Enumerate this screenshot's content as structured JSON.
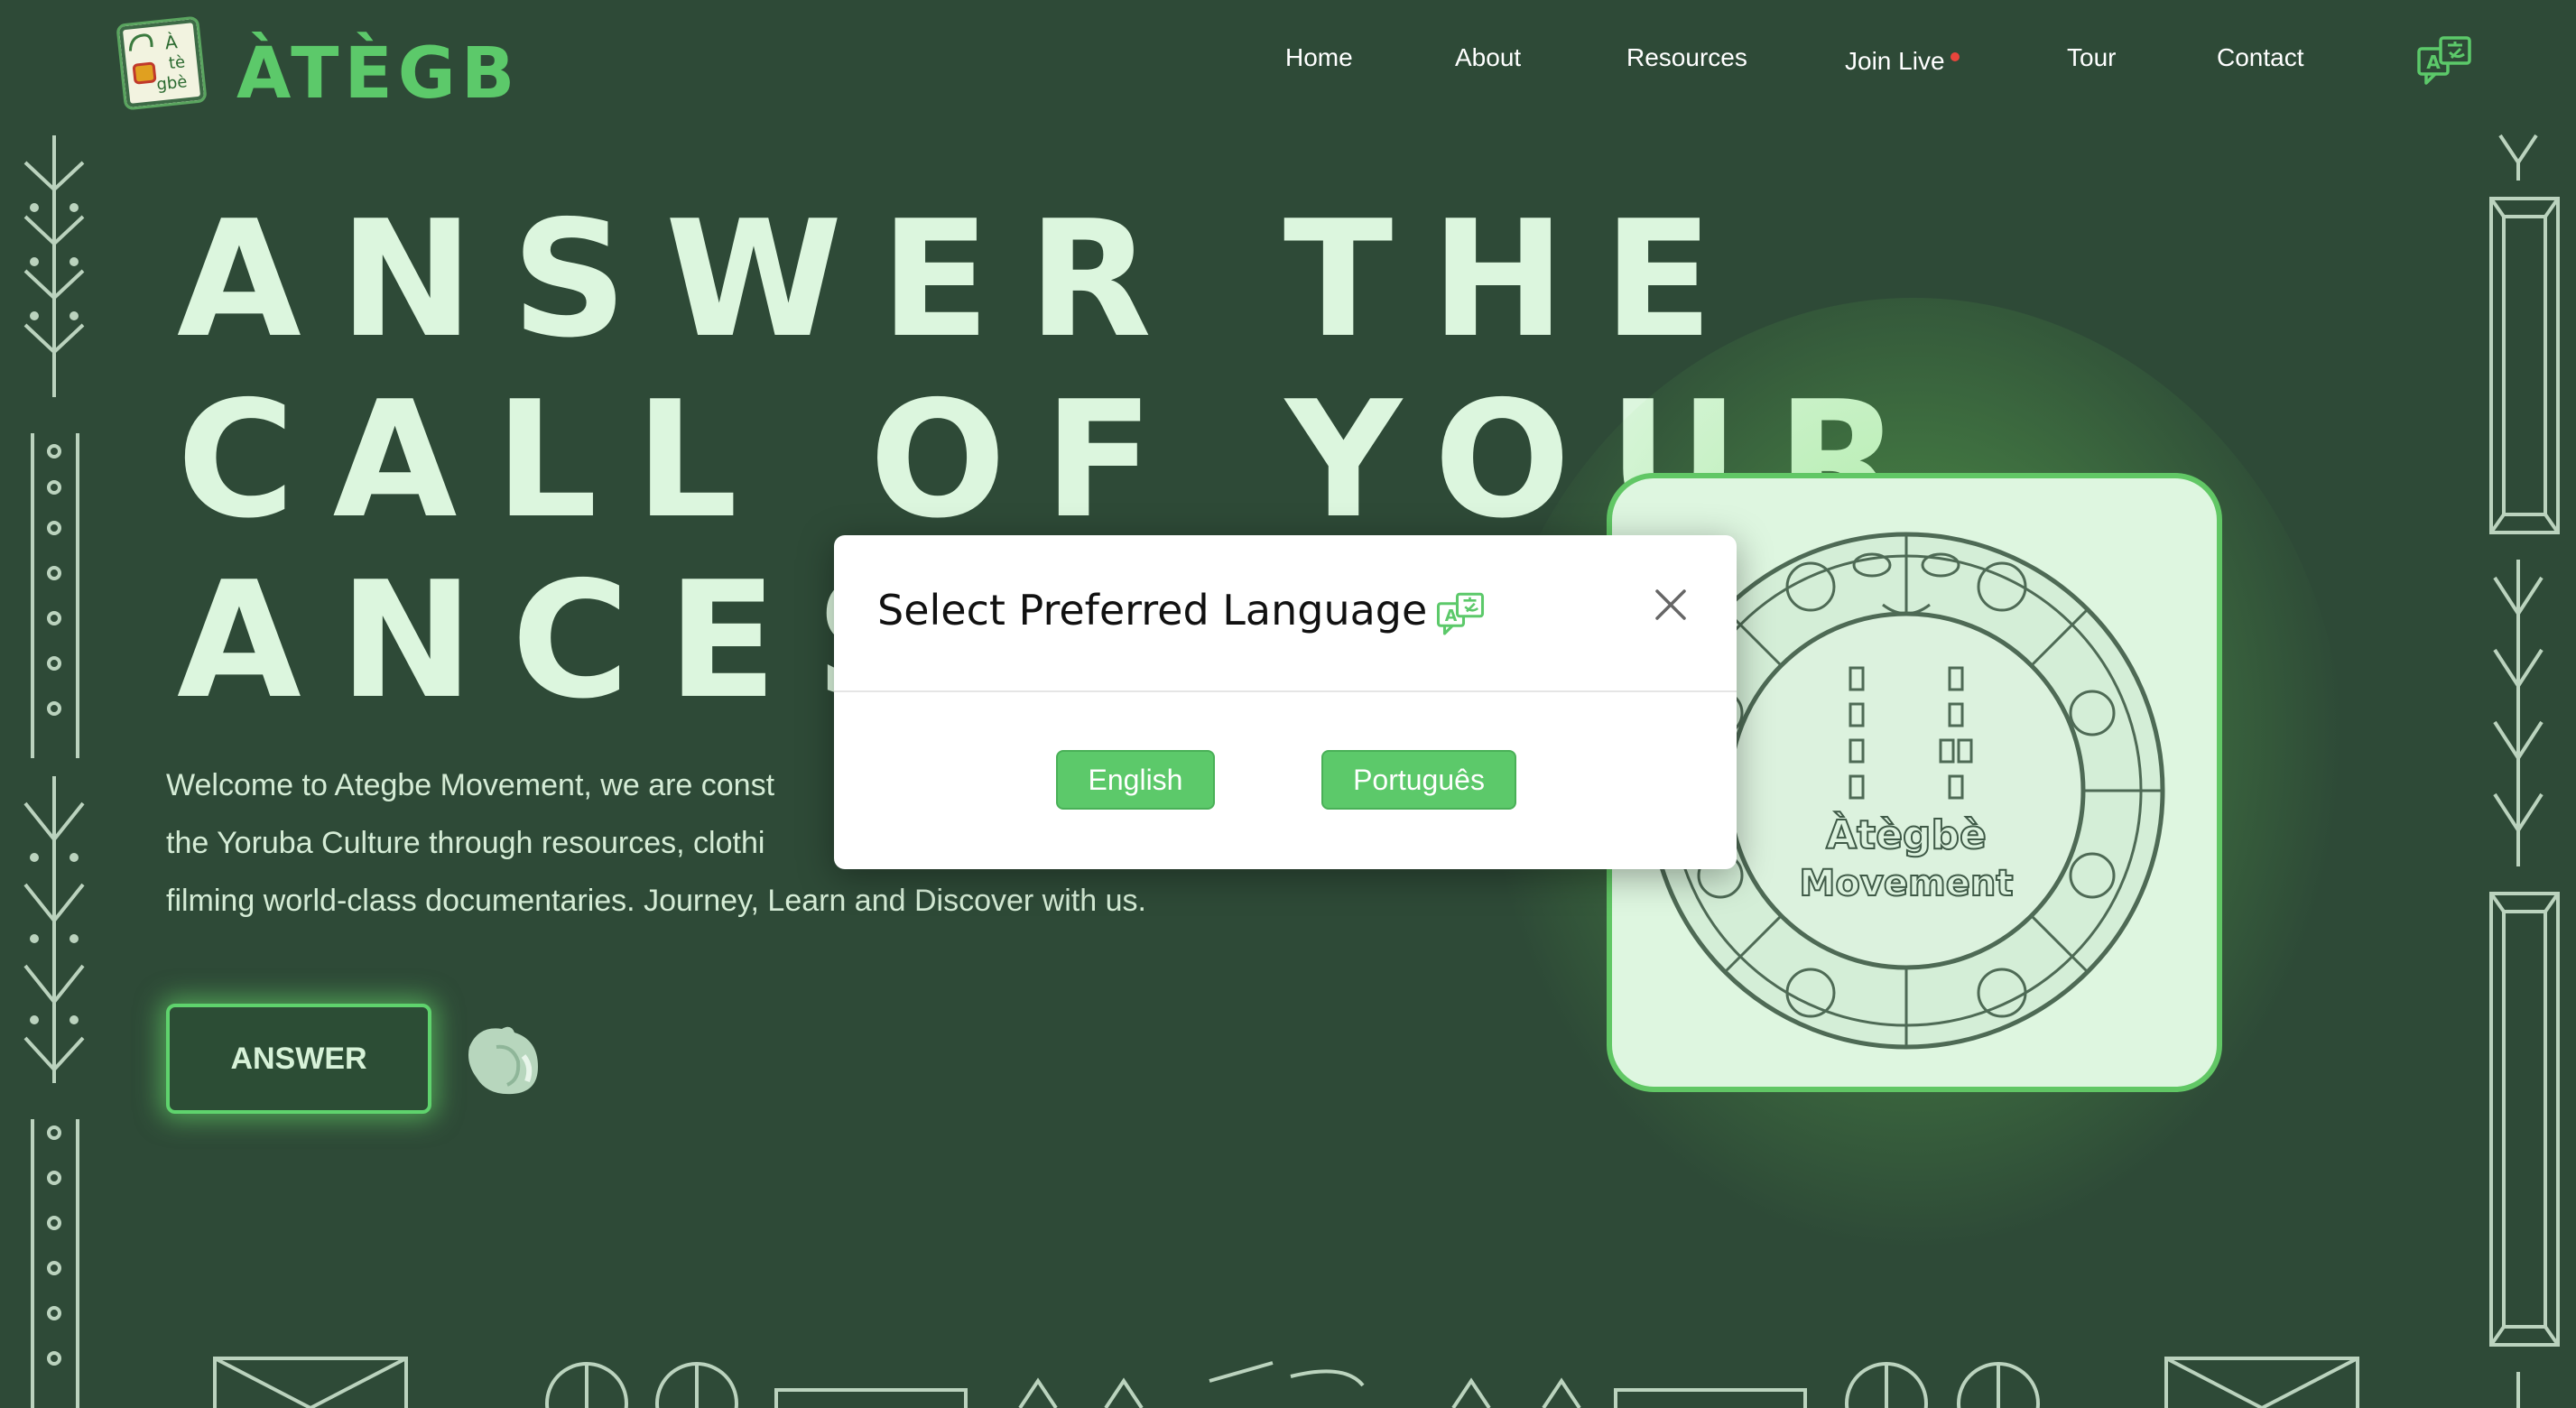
{
  "brand": {
    "badge_lines": [
      "À",
      "tè",
      "gbè"
    ],
    "wordmark": "ÀTÈGBÈ"
  },
  "nav": {
    "items": [
      "Home",
      "About",
      "Resources",
      "Join Live",
      "Tour",
      "Contact"
    ],
    "live_indicator_color": "#e8453c",
    "translate_icon": "translate-icon"
  },
  "hero": {
    "title_lines": [
      "ANSWER THE",
      "CALL OF YOUR",
      "ANCESTO"
    ],
    "text_lines": [
      "Welcome to Ategbe Movement, we are const",
      "the Yoruba Culture through resources, clothi",
      "filming world-class documentaries. Journey, Learn and Discover with us."
    ],
    "cta_label": "ANSWER",
    "shell_icon": "cowrie-shell-icon"
  },
  "emblem": {
    "line1": "Àtègbè",
    "line2": "Movement"
  },
  "modal": {
    "title": "Select Preferred Language",
    "close_icon": "close-icon",
    "languages": [
      "English",
      "Português"
    ]
  },
  "colors": {
    "background": "#2e4a37",
    "accent_green": "#5cc96a",
    "light_green": "#def6e0",
    "glow_green": "#5fd36d"
  }
}
